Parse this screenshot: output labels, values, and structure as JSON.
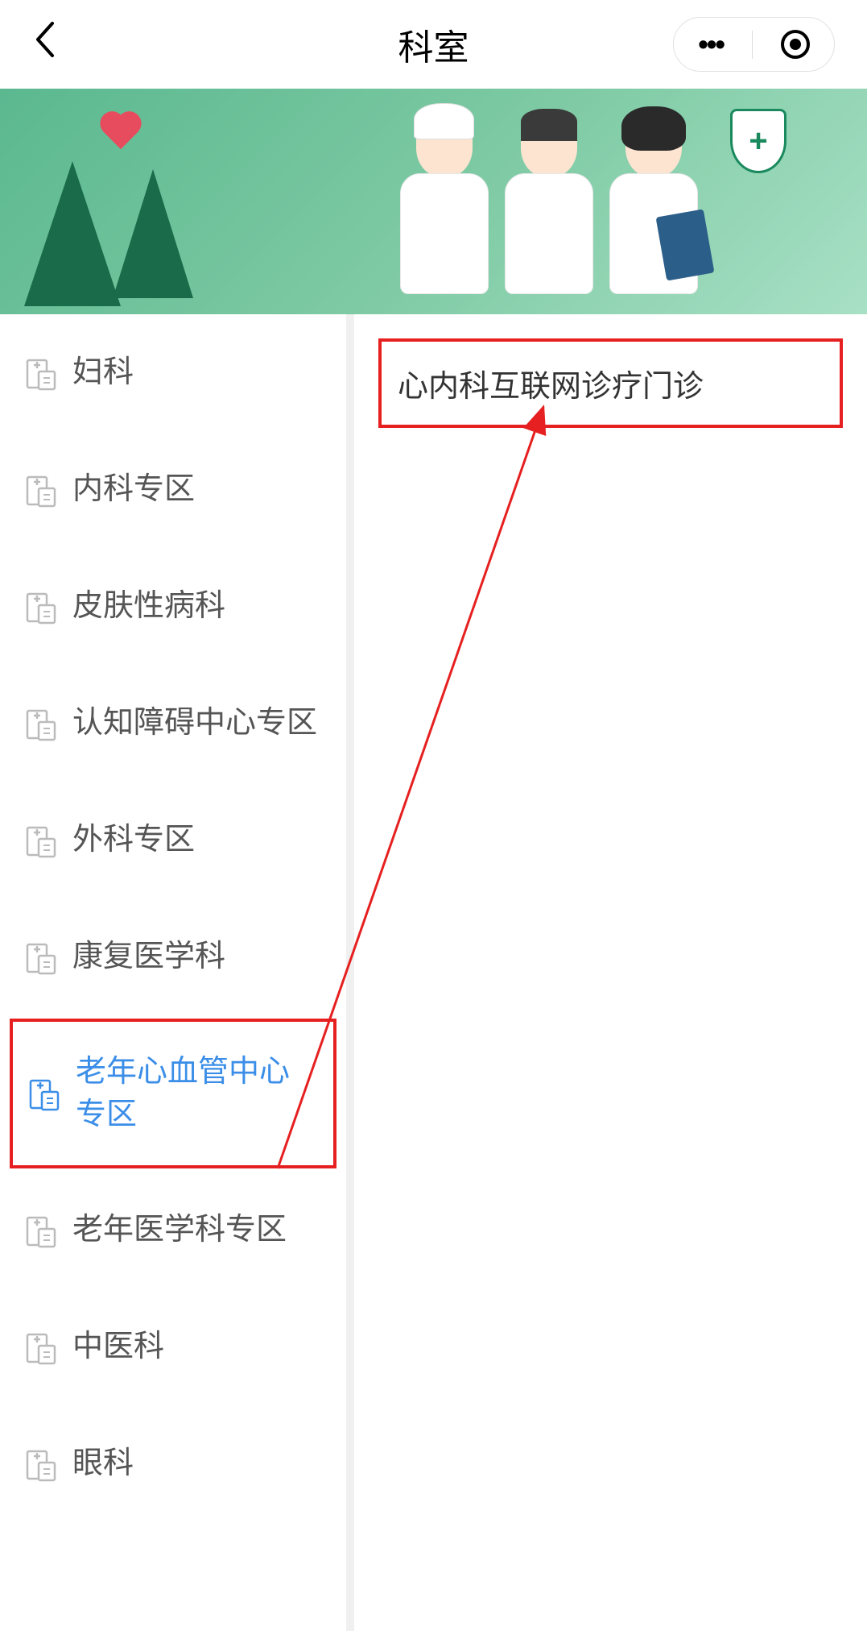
{
  "header": {
    "title": "科室"
  },
  "sidebar": {
    "items": [
      {
        "label": "妇科",
        "active": false,
        "highlighted": false
      },
      {
        "label": "内科专区",
        "active": false,
        "highlighted": false
      },
      {
        "label": "皮肤性病科",
        "active": false,
        "highlighted": false
      },
      {
        "label": "认知障碍中心专区",
        "active": false,
        "highlighted": false
      },
      {
        "label": "外科专区",
        "active": false,
        "highlighted": false
      },
      {
        "label": "康复医学科",
        "active": false,
        "highlighted": false
      },
      {
        "label": "老年心血管中心专区",
        "active": true,
        "highlighted": true
      },
      {
        "label": "老年医学科专区",
        "active": false,
        "highlighted": false
      },
      {
        "label": "中医科",
        "active": false,
        "highlighted": false
      },
      {
        "label": "眼科",
        "active": false,
        "highlighted": false
      }
    ]
  },
  "main": {
    "clinic": "心内科互联网诊疗门诊"
  },
  "banner": {
    "shield_symbol": "+"
  },
  "annotation": {
    "arrow_color": "#e62020"
  }
}
